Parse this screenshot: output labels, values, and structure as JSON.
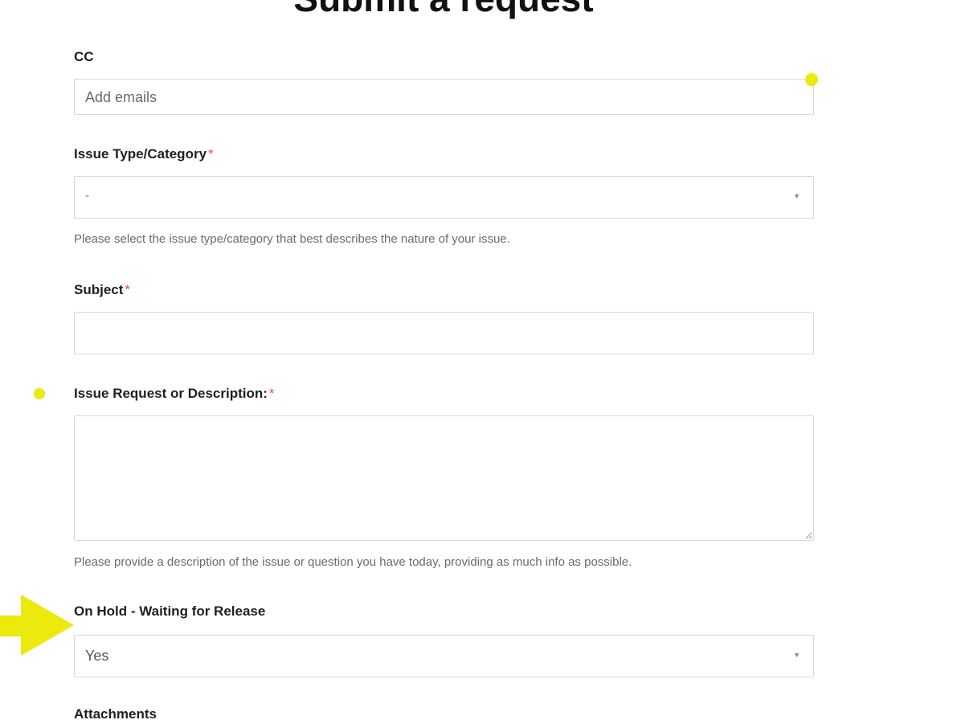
{
  "page": {
    "title": "Submit a request"
  },
  "form": {
    "cc": {
      "label": "CC",
      "placeholder": "Add emails"
    },
    "issue_type": {
      "label": "Issue Type/Category",
      "required_mark": "*",
      "selected": "-",
      "hint": "Please select the issue type/category that best describes the nature of your issue."
    },
    "subject": {
      "label": "Subject",
      "required_mark": "*",
      "value": ""
    },
    "description": {
      "label": "Issue Request or Description:",
      "required_mark": "*",
      "value": "",
      "hint": "Please provide a description of the issue or question you have today, providing as much info as possible."
    },
    "on_hold": {
      "label": "On Hold - Waiting for Release",
      "selected": "Yes"
    },
    "attachments": {
      "label": "Attachments"
    }
  },
  "icons": {
    "dropdown_arrow": "chevron-down-icon",
    "resize": "resize-handle-icon",
    "annotation_arrow": "arrow-right-icon",
    "annotation_dot": "dot-marker-icon"
  },
  "colors": {
    "annotation": "#ecea0c",
    "required": "#e05050",
    "border": "#d8d8d8"
  }
}
